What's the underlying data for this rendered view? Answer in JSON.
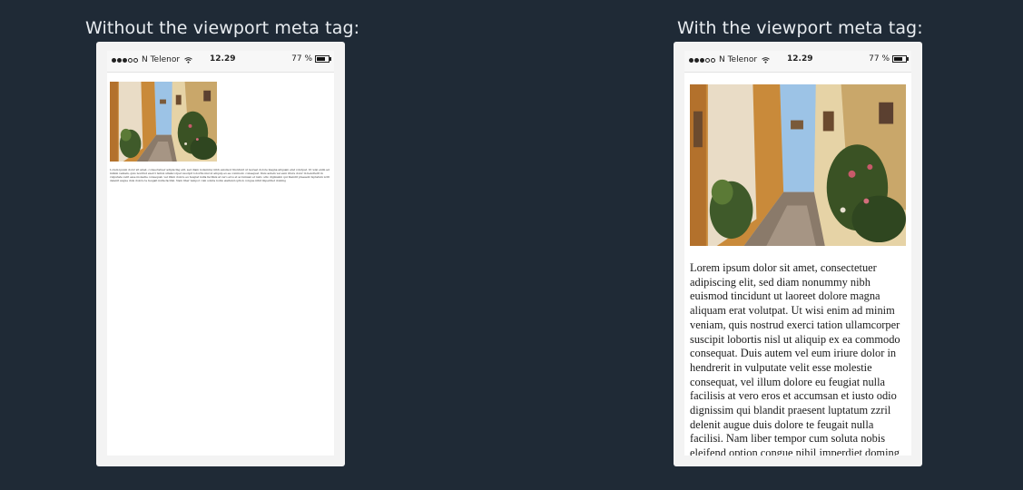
{
  "captions": {
    "left": "Without the viewport meta tag:",
    "right": "With the viewport meta tag:"
  },
  "statusbar": {
    "carrier": "N Telenor",
    "time": "12.29",
    "battery_text": "77 %",
    "battery_level": 0.77,
    "signal_bars_filled": 3,
    "signal_bars_total": 5
  },
  "photo": {
    "subject": "narrow alley with old houses and plants",
    "colors": {
      "wall_ochre": "#c98a3a",
      "wall_light": "#e9dcc6",
      "sky": "#9cc3e6",
      "foliage": "#3f5a2a",
      "pavement": "#8a7a6a"
    }
  },
  "body_text": "Lorem ipsum dolor sit amet, consectetuer adipiscing elit, sed diam nonummy nibh euismod tincidunt ut laoreet dolore magna aliquam erat volutpat. Ut wisi enim ad minim veniam, quis nostrud exerci tation ullamcorper suscipit lobortis nisl ut aliquip ex ea commodo consequat. Duis autem vel eum iriure dolor in hendrerit in vulputate velit esse molestie consequat, vel illum dolore eu feugiat nulla facilisis at vero eros et accumsan et iusto odio dignissim qui blandit praesent luptatum zzril delenit augue duis dolore te feugait nulla facilisi. Nam liber tempor cum soluta nobis eleifend option congue nihil imperdiet doming",
  "theme": {
    "page_background": "#1f2a36",
    "caption_color": "#e8ecf0",
    "frame_color": "#f3f3f3"
  }
}
